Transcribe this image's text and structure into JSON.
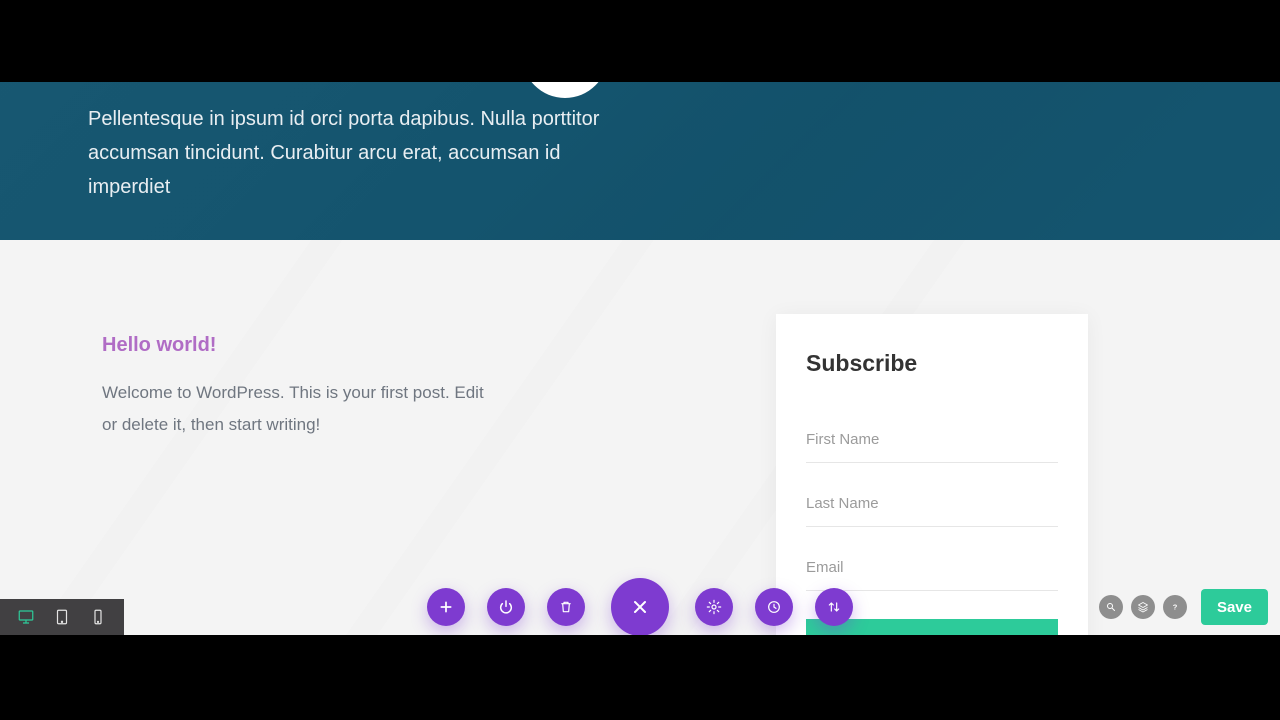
{
  "hero": {
    "text": "Pellentesque in ipsum id orci porta dapibus. Nulla porttitor accumsan tincidunt. Curabitur arcu erat, accumsan id imperdiet"
  },
  "post": {
    "title": "Hello world!",
    "body": "Welcome to WordPress. This is your first post. Edit or delete it, then start writing!"
  },
  "subscribe": {
    "heading": "Subscribe",
    "first_name_placeholder": "First Name",
    "last_name_placeholder": "Last Name",
    "email_placeholder": "Email"
  },
  "toolbar": {
    "save_label": "Save"
  },
  "icons": {
    "desktop": "desktop-icon",
    "tablet": "tablet-icon",
    "phone": "phone-icon",
    "plus": "plus-icon",
    "power": "power-icon",
    "trash": "trash-icon",
    "close": "close-icon",
    "gear": "gear-icon",
    "clock": "clock-icon",
    "sort": "sort-icon",
    "search": "search-icon",
    "layers": "layers-icon",
    "help": "help-icon"
  }
}
